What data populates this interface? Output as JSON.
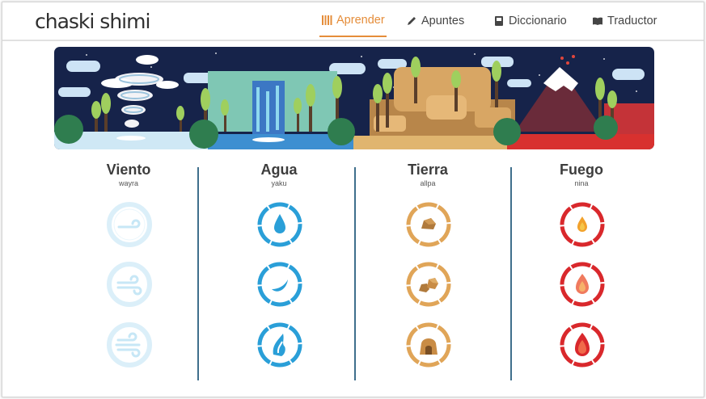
{
  "app": {
    "logo": "chaski shimi"
  },
  "nav": {
    "items": [
      {
        "label": "Aprender",
        "icon": "bars-icon",
        "active": true
      },
      {
        "label": "Apuntes",
        "icon": "pencil-icon",
        "active": false
      },
      {
        "label": "Diccionario",
        "icon": "book-icon",
        "active": false
      },
      {
        "label": "Traductor",
        "icon": "open-book-icon",
        "active": false
      }
    ]
  },
  "colors": {
    "accent": "#e58d3a",
    "divider": "#3f6f8c",
    "wind": "#bfe6f7",
    "water": "#2a9fd8",
    "earth": "#e0a558",
    "fire": "#d9282c"
  },
  "elements": [
    {
      "title": "Viento",
      "subtitle": "wayra",
      "skills": [
        "wind-level-1-icon",
        "wind-level-2-icon",
        "wind-level-3-icon"
      ]
    },
    {
      "title": "Agua",
      "subtitle": "yaku",
      "skills": [
        "water-drop-icon",
        "water-wave-icon",
        "water-splash-icon"
      ]
    },
    {
      "title": "Tierra",
      "subtitle": "allpa",
      "skills": [
        "rock-icon",
        "rocks-icon",
        "cave-icon"
      ]
    },
    {
      "title": "Fuego",
      "subtitle": "nina",
      "skills": [
        "flame-small-icon",
        "flame-medium-icon",
        "flame-large-icon"
      ]
    }
  ]
}
